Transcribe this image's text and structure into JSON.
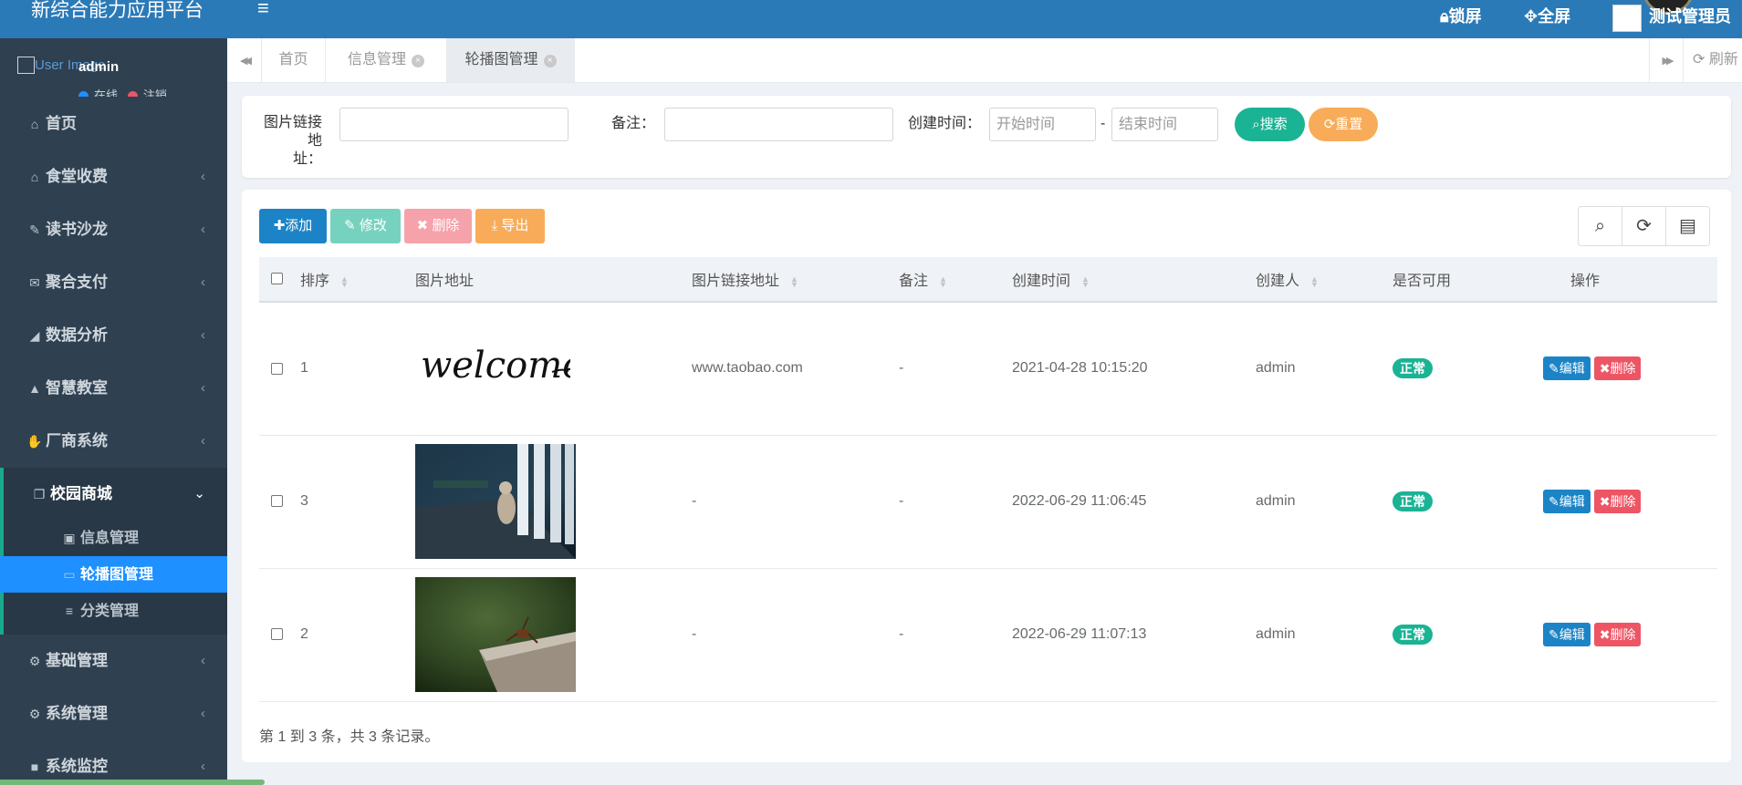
{
  "app": {
    "title": "新综合能力应用平台"
  },
  "user": {
    "photo_alt": "User Image",
    "name": "admin",
    "status_online": "在线",
    "status_logout": "注销"
  },
  "sidebar": {
    "items": [
      {
        "label": "首页",
        "icon": "home-icon",
        "glyph": "⌂"
      },
      {
        "label": "食堂收费",
        "icon": "bank-icon",
        "glyph": "⌂",
        "arrow": "‹"
      },
      {
        "label": "读书沙龙",
        "icon": "brush-icon",
        "glyph": "✎",
        "arrow": "‹"
      },
      {
        "label": "聚合支付",
        "icon": "comments-icon",
        "glyph": "✉",
        "arrow": "‹"
      },
      {
        "label": "数据分析",
        "icon": "area-chart-icon",
        "glyph": "◢",
        "arrow": "‹"
      },
      {
        "label": "智慧教室",
        "icon": "graduation-cap-icon",
        "glyph": "▲",
        "arrow": "‹"
      },
      {
        "label": "厂商系统",
        "icon": "hand-icon",
        "glyph": "✋",
        "arrow": "‹"
      },
      {
        "label": "校园商城",
        "icon": "clone-icon",
        "glyph": "❐",
        "arrow": "⌄"
      },
      {
        "label": "基础管理",
        "icon": "cogs-icon",
        "glyph": "⚙",
        "arrow": "‹"
      },
      {
        "label": "系统管理",
        "icon": "gear-icon",
        "glyph": "⚙",
        "arrow": "‹"
      },
      {
        "label": "系统监控",
        "icon": "video-camera-icon",
        "glyph": "■",
        "arrow": "‹"
      }
    ],
    "sub_items": [
      {
        "label": "信息管理",
        "icon": "image-icon",
        "glyph": "▣"
      },
      {
        "label": "轮播图管理",
        "icon": "desktop-icon",
        "glyph": "▭"
      },
      {
        "label": "分类管理",
        "icon": "list-icon",
        "glyph": "≡"
      }
    ]
  },
  "topbar": {
    "menu_glyph": "≡",
    "lock": "锁屏",
    "fullscreen": "全屏",
    "username": "测试管理员"
  },
  "tabs": {
    "items": [
      "首页",
      "信息管理",
      "轮播图管理"
    ],
    "close_glyph": "×",
    "refresh": "刷新",
    "prev": "◀◀",
    "next": "▶▶"
  },
  "search": {
    "link_label_line1": "图片链接地",
    "link_label_line2": "址：",
    "remark_label": "备注：",
    "time_label": "创建时间：",
    "start_placeholder": "开始时间",
    "end_placeholder": "结束时间",
    "dash": "-",
    "search_btn": "搜索",
    "reset_btn": "重置"
  },
  "toolbar": {
    "add": "添加",
    "edit": "修改",
    "delete": "删除",
    "export": "导出"
  },
  "table": {
    "columns": [
      "排序",
      "图片地址",
      "图片链接地址",
      "备注",
      "创建时间",
      "创建人",
      "是否可用",
      "操作"
    ],
    "rows": [
      {
        "sort": "1",
        "image": "welcome",
        "link": "www.taobao.com",
        "remark": "-",
        "time": "2021-04-28 10:15:20",
        "creator": "admin",
        "status": "正常"
      },
      {
        "sort": "3",
        "image": "cat-photo",
        "link": "-",
        "remark": "-",
        "time": "2022-06-29 11:06:45",
        "creator": "admin",
        "status": "正常"
      },
      {
        "sort": "2",
        "image": "insect-photo",
        "link": "-",
        "remark": "-",
        "time": "2022-06-29 11:07:13",
        "creator": "admin",
        "status": "正常"
      }
    ],
    "welcome_text": "welcome",
    "edit_btn": "编辑",
    "delete_btn": "删除"
  },
  "pagination": {
    "summary": "第 1 到 3 条，共 3 条记录。"
  },
  "colors": {
    "primary": "#2b7ab8",
    "sidebar": "#2f4050",
    "active_menu": "#1e90ff",
    "success": "#1ab394",
    "danger": "#ed5565",
    "warning": "#f8ac59"
  }
}
